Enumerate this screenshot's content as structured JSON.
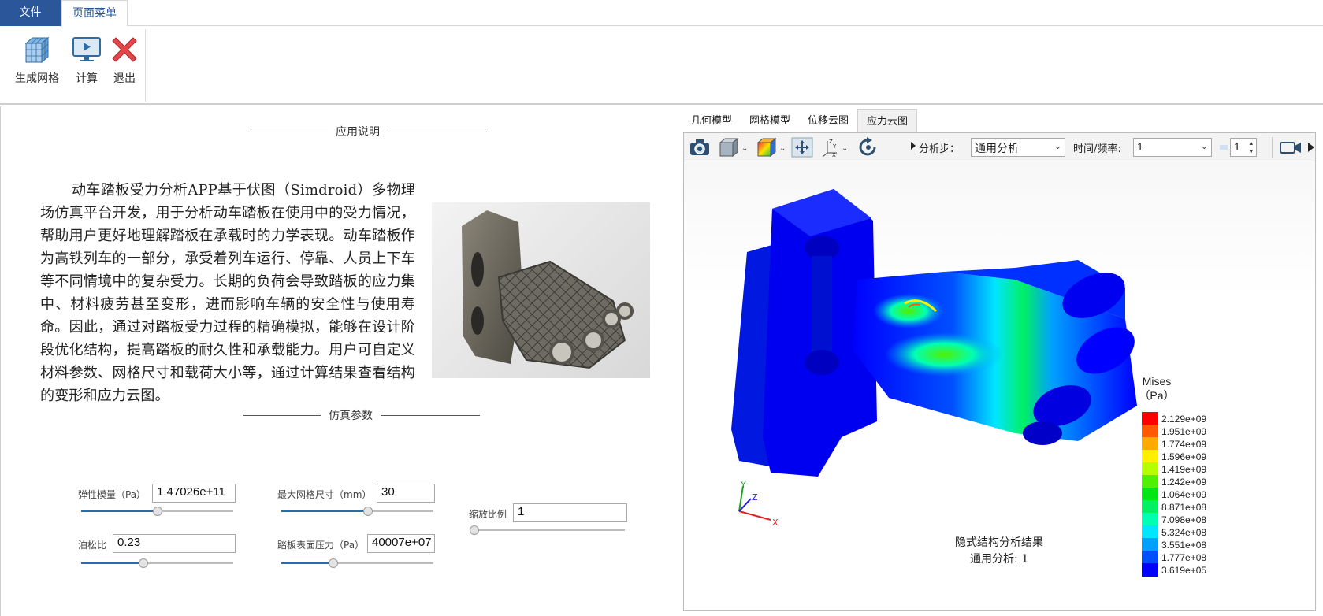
{
  "tabs": {
    "file": "文件",
    "page_menu": "页面菜单"
  },
  "ribbon": {
    "gen_mesh": "生成网格",
    "compute": "计算",
    "exit": "退出"
  },
  "left": {
    "app_desc_title": "应用说明",
    "description": "动车踏板受力分析APP基于伏图（Simdroid）多物理场仿真平台开发，用于分析动车踏板在使用中的受力情况，帮助用户更好地理解踏板在承载时的力学表现。动车踏板作为高铁列车的一部分，承受着列车运行、停靠、人员上下车等不同情境中的复杂受力。长期的负荷会导致踏板的应力集中、材料疲劳甚至变形，进而影响车辆的安全性与使用寿命。因此，通过对踏板受力过程的精确模拟，能够在设计阶段优化结构，提高踏板的耐久性和承载能力。用户可自定义材料参数、网格尺寸和载荷大小等，通过计算结果查看结构的变形和应力云图。",
    "params_title": "仿真参数",
    "params": {
      "elastic_modulus": {
        "label": "弹性模量（Pa）",
        "value": "1.47026e+11",
        "slider": 0.5
      },
      "max_mesh": {
        "label": "最大网格尺寸（mm）",
        "value": "30",
        "slider": 0.57
      },
      "scale": {
        "label": "缩放比例",
        "value": "1",
        "slider": 0.0
      },
      "poisson": {
        "label": "泊松比",
        "value": "0.23",
        "slider": 0.4
      },
      "pressure": {
        "label": "踏板表面压力（Pa）",
        "value": "40007e+07",
        "slider": 0.34
      }
    }
  },
  "viewer": {
    "tabs": [
      "几何模型",
      "网格模型",
      "位移云图",
      "应力云图"
    ],
    "active_tab": 3,
    "step_label": "分析步：",
    "step_value": "通用分析",
    "time_label": "时间/频率:",
    "time_value": "1",
    "frame_value": "1",
    "legend": {
      "title": "Mises",
      "unit": "（Pa）",
      "entries": [
        {
          "value": "2.129e+09",
          "color": "#ff0000"
        },
        {
          "value": "1.951e+09",
          "color": "#ff5a00"
        },
        {
          "value": "1.774e+09",
          "color": "#ffaa00"
        },
        {
          "value": "1.596e+09",
          "color": "#fff000"
        },
        {
          "value": "1.419e+09",
          "color": "#b4ff00"
        },
        {
          "value": "1.242e+09",
          "color": "#50f000"
        },
        {
          "value": "1.064e+09",
          "color": "#00e614"
        },
        {
          "value": "8.871e+08",
          "color": "#00f064"
        },
        {
          "value": "7.098e+08",
          "color": "#00ffb4"
        },
        {
          "value": "5.324e+08",
          "color": "#00e6ff"
        },
        {
          "value": "3.551e+08",
          "color": "#00a0ff"
        },
        {
          "value": "1.777e+08",
          "color": "#0050ff"
        },
        {
          "value": "3.619e+05",
          "color": "#0000ff"
        }
      ]
    },
    "result_title": "隐式结构分析结果",
    "result_sub": "通用分析: 1",
    "axes": {
      "x": "X",
      "y": "Y",
      "z": "Z"
    }
  }
}
